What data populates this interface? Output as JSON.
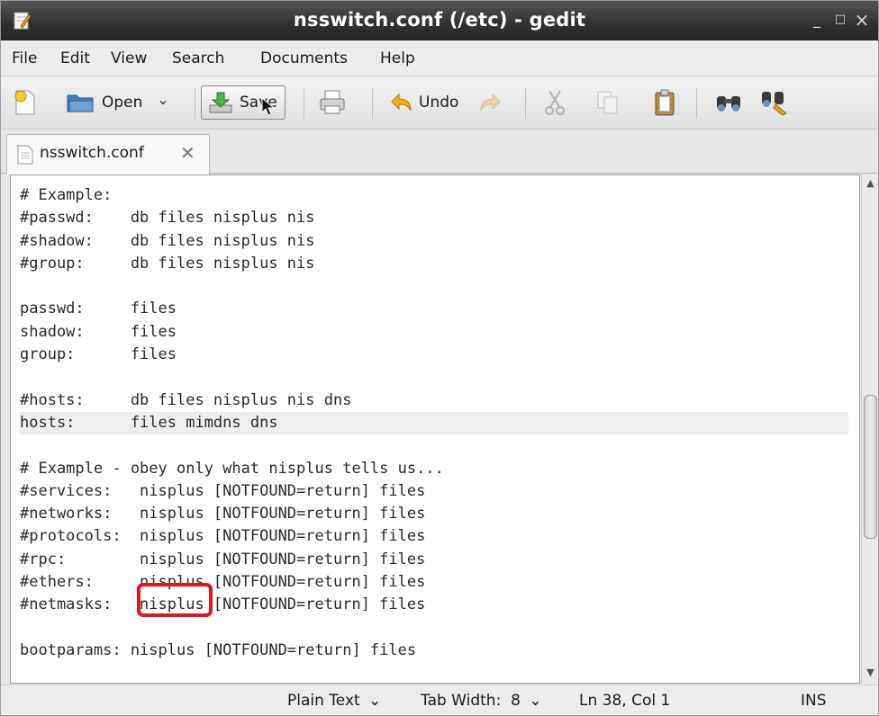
{
  "window": {
    "title": "nsswitch.conf (/etc) - gedit",
    "minimize_glyph": "_",
    "maximize_glyph": "□",
    "close_glyph": "×",
    "app_icon": "gedit-pencil-icon"
  },
  "menubar": {
    "items": [
      "File",
      "Edit",
      "View",
      "Search",
      "Documents",
      "Help"
    ]
  },
  "toolbar": {
    "new_icon": "new-document-icon",
    "open_label": "Open",
    "open_dropdown_glyph": "⌄",
    "save_label": "Save",
    "print_icon": "printer-icon",
    "undo_label": "Undo",
    "redo_icon": "redo-icon",
    "cut_icon": "scissors-icon",
    "copy_icon": "copy-icon",
    "paste_icon": "clipboard-icon",
    "find_icon": "binoculars-icon",
    "replace_icon": "find-replace-icon"
  },
  "tabs": [
    {
      "label": "nsswitch.conf",
      "close_glyph": "✕"
    }
  ],
  "editor": {
    "lines": [
      "# Example:",
      "#passwd:    db files nisplus nis",
      "#shadow:    db files nisplus nis",
      "#group:     db files nisplus nis",
      "",
      "passwd:     files",
      "shadow:     files",
      "group:      files",
      "",
      "#hosts:     db files nisplus nis dns",
      "hosts:      files mimdns dns",
      "",
      "# Example - obey only what nisplus tells us...",
      "#services:   nisplus [NOTFOUND=return] files",
      "#networks:   nisplus [NOTFOUND=return] files",
      "#protocols:  nisplus [NOTFOUND=return] files",
      "#rpc:        nisplus [NOTFOUND=return] files",
      "#ethers:     nisplus [NOTFOUND=return] files",
      "#netmasks:   nisplus [NOTFOUND=return] files",
      "",
      "bootparams: nisplus [NOTFOUND=return] files"
    ],
    "current_line_index": 10,
    "highlight_color": "#e01818"
  },
  "statusbar": {
    "language": "Plain Text",
    "language_dropdown_glyph": "⌄",
    "tab_width": "Tab Width:  8",
    "tab_width_dropdown_glyph": "⌄",
    "cursor_position": "Ln 38, Col 1",
    "insert_mode": "INS"
  },
  "scrollbar": {
    "up_glyph": "▲",
    "down_glyph": "▼"
  }
}
